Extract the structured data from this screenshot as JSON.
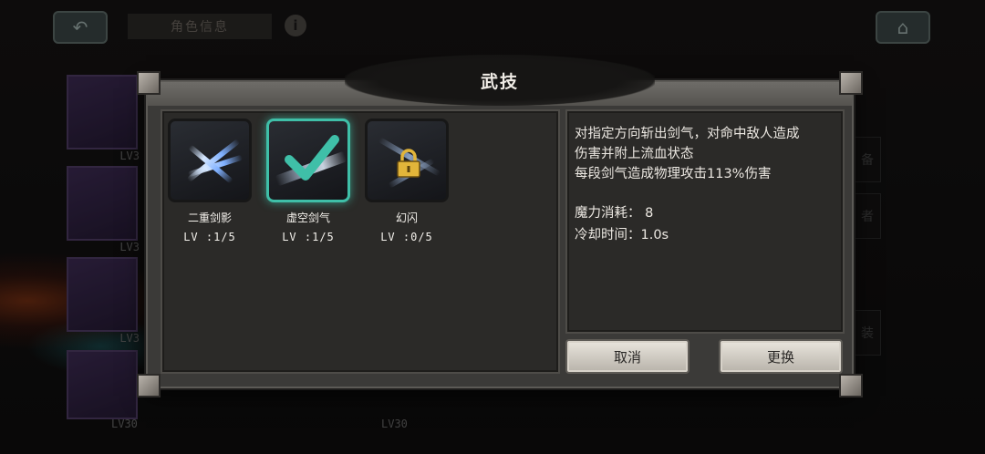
{
  "header": {
    "title": "角色信息"
  },
  "sidebar": {
    "equip_levels": [
      "LV3",
      "LV3",
      "LV3",
      "LV30"
    ],
    "extra_level": "LV30"
  },
  "right_tabs": [
    "备",
    "者",
    "装"
  ],
  "dialog": {
    "title": "武技",
    "skills": [
      {
        "name": "二重剑影",
        "level": "LV :1/5",
        "state": "normal",
        "icon": "cross-slash-icon"
      },
      {
        "name": "虚空剑气",
        "level": "LV :1/5",
        "state": "selected",
        "icon": "check-icon"
      },
      {
        "name": "幻闪",
        "level": "LV :0/5",
        "state": "locked",
        "icon": "lock-icon"
      }
    ],
    "description": {
      "line1": "对指定方向斩出剑气，对命中敌人造成",
      "line2": "伤害并附上流血状态",
      "line3": "每段剑气造成物理攻击113%伤害",
      "mana_cost": "魔力消耗：  8",
      "cooldown": "冷却时间：1.0s"
    },
    "buttons": {
      "cancel": "取消",
      "replace": "更换"
    }
  },
  "colors": {
    "selected": "#3fbfa8",
    "lock": "#e2b53a"
  }
}
